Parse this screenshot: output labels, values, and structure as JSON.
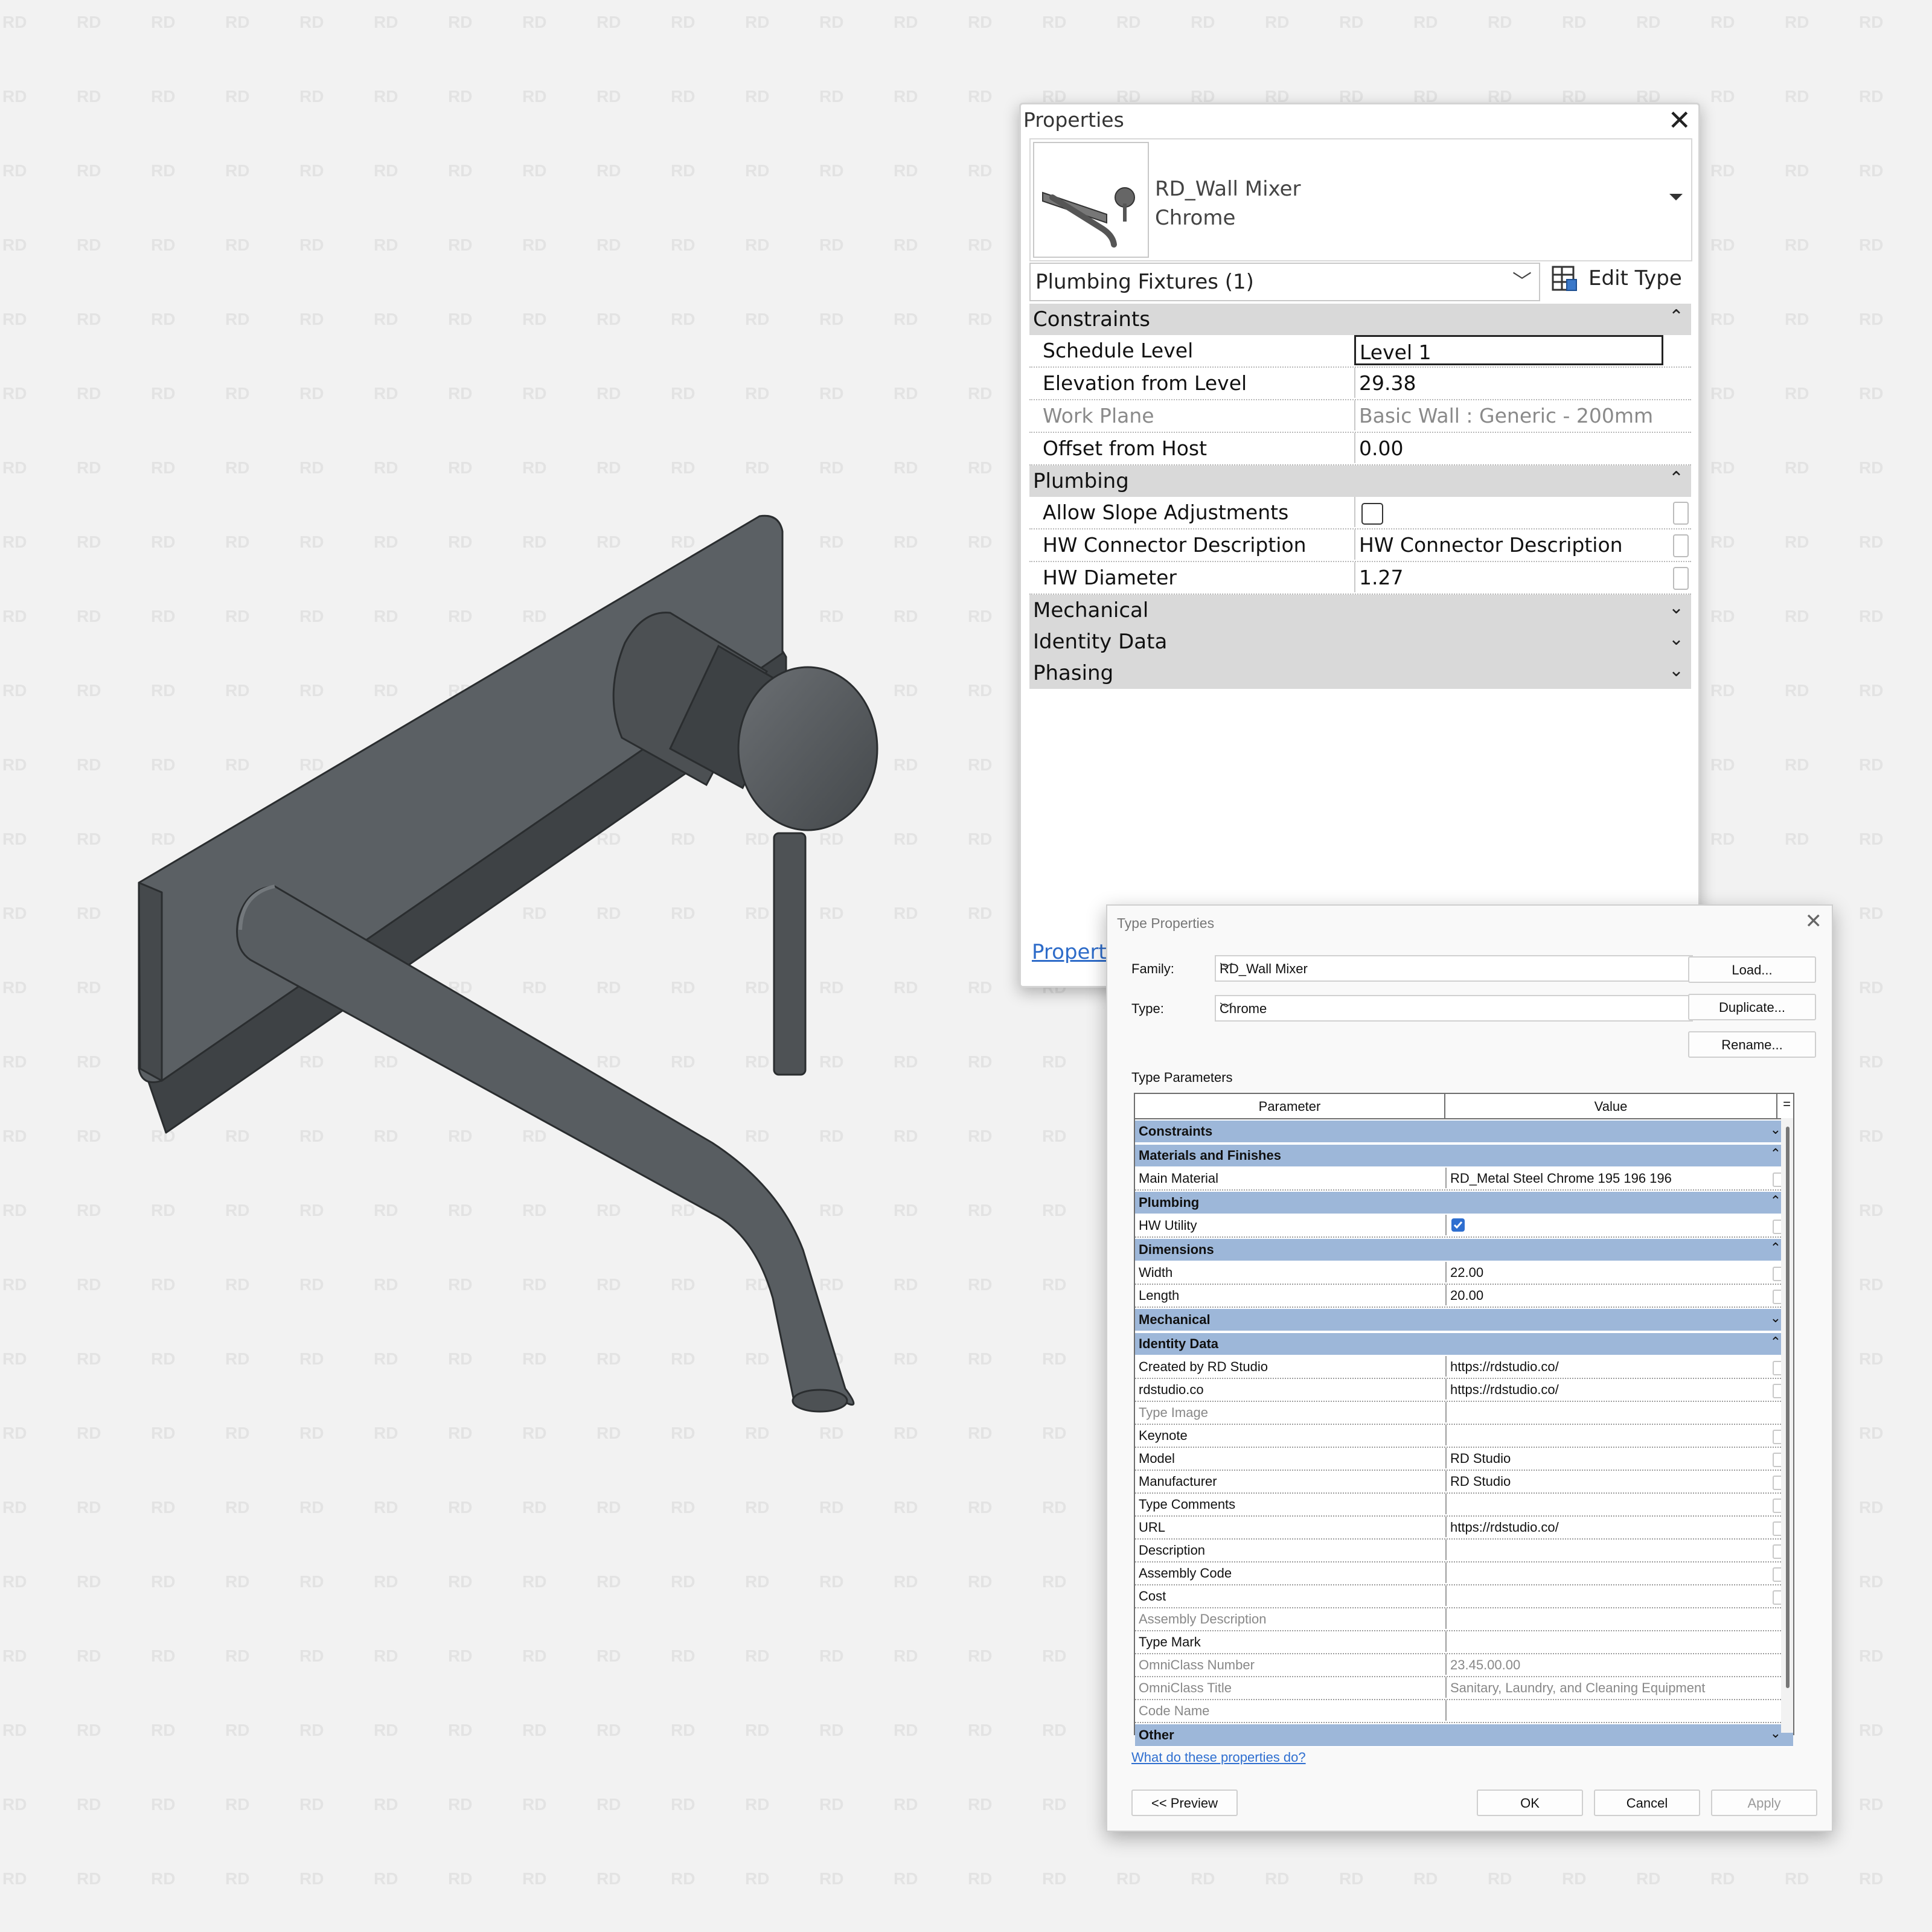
{
  "watermark": {
    "text": "RD"
  },
  "properties": {
    "title": "Properties",
    "close_icon": "close-icon",
    "family_name": "RD_Wall Mixer",
    "type_name": "Chrome",
    "category": "Plumbing Fixtures (1)",
    "edit_type_label": "Edit Type",
    "sections": [
      {
        "label": "Constraints",
        "expanded": true,
        "rows": [
          {
            "name": "Schedule Level",
            "value": "Level 1",
            "selected": true
          },
          {
            "name": "Elevation from Level",
            "value": "29.38"
          },
          {
            "name": "Work Plane",
            "value": "Basic Wall : Generic - 200mm",
            "readonly": true
          },
          {
            "name": "Offset from Host",
            "value": "0.00"
          }
        ]
      },
      {
        "label": "Plumbing",
        "expanded": true,
        "rows": [
          {
            "name": "Allow Slope Adjustments",
            "checkbox": false
          },
          {
            "name": "HW Connector Description",
            "value": "HW Connector Description"
          },
          {
            "name": "HW Diameter",
            "value": "1.27"
          }
        ]
      },
      {
        "label": "Mechanical",
        "expanded": false
      },
      {
        "label": "Identity Data",
        "expanded": false
      },
      {
        "label": "Phasing",
        "expanded": false
      }
    ],
    "footer_link": "Properti"
  },
  "type_properties": {
    "title": "Type Properties",
    "family_label": "Family:",
    "family_value": "RD_Wall Mixer",
    "type_label": "Type:",
    "type_value": "Chrome",
    "load_button": "Load...",
    "duplicate_button": "Duplicate...",
    "rename_button": "Rename...",
    "type_parameters_label": "Type Parameters",
    "col_parameter": "Parameter",
    "col_value": "Value",
    "col_eq": "=",
    "groups": [
      {
        "label": "Constraints",
        "expanded": false,
        "rows": []
      },
      {
        "label": "Materials and Finishes",
        "expanded": true,
        "rows": [
          {
            "name": "Main Material",
            "value": "RD_Metal Steel Chrome 195 196 196"
          }
        ]
      },
      {
        "label": "Plumbing",
        "expanded": true,
        "rows": [
          {
            "name": "HW Utility",
            "checkbox": true
          }
        ]
      },
      {
        "label": "Dimensions",
        "expanded": true,
        "rows": [
          {
            "name": "Width",
            "value": "22.00"
          },
          {
            "name": "Length",
            "value": "20.00"
          }
        ]
      },
      {
        "label": "Mechanical",
        "expanded": false,
        "rows": []
      },
      {
        "label": "Identity Data",
        "expanded": true,
        "rows": [
          {
            "name": "Created by RD Studio",
            "value": "https://rdstudio.co/"
          },
          {
            "name": "rdstudio.co",
            "value": "https://rdstudio.co/"
          },
          {
            "name": "Type Image",
            "value": "",
            "dim": true,
            "nosq": true
          },
          {
            "name": "Keynote",
            "value": ""
          },
          {
            "name": "Model",
            "value": "RD Studio"
          },
          {
            "name": "Manufacturer",
            "value": "RD Studio"
          },
          {
            "name": "Type Comments",
            "value": ""
          },
          {
            "name": "URL",
            "value": "https://rdstudio.co/"
          },
          {
            "name": "Description",
            "value": ""
          },
          {
            "name": "Assembly Code",
            "value": ""
          },
          {
            "name": "Cost",
            "value": ""
          },
          {
            "name": "Assembly Description",
            "value": "",
            "dim": true,
            "nosq": true
          },
          {
            "name": "Type Mark",
            "value": "",
            "nosq": true
          },
          {
            "name": "OmniClass Number",
            "value": "23.45.00.00",
            "dim": true,
            "nosq": true
          },
          {
            "name": "OmniClass Title",
            "value": "Sanitary, Laundry, and Cleaning Equipment",
            "dim": true,
            "nosq": true
          },
          {
            "name": "Code Name",
            "value": "",
            "dim": true,
            "nosq": true
          }
        ]
      },
      {
        "label": "Other",
        "expanded": false,
        "rows": []
      }
    ],
    "help_link": "What do these properties do?",
    "preview_button": "<< Preview",
    "ok_button": "OK",
    "cancel_button": "Cancel",
    "apply_button": "Apply"
  },
  "colors": {
    "group_header": "#9db7d9",
    "checkbox_checked": "#2f6fd0",
    "link": "#2e6cc9",
    "faucet": "#555a5e"
  }
}
